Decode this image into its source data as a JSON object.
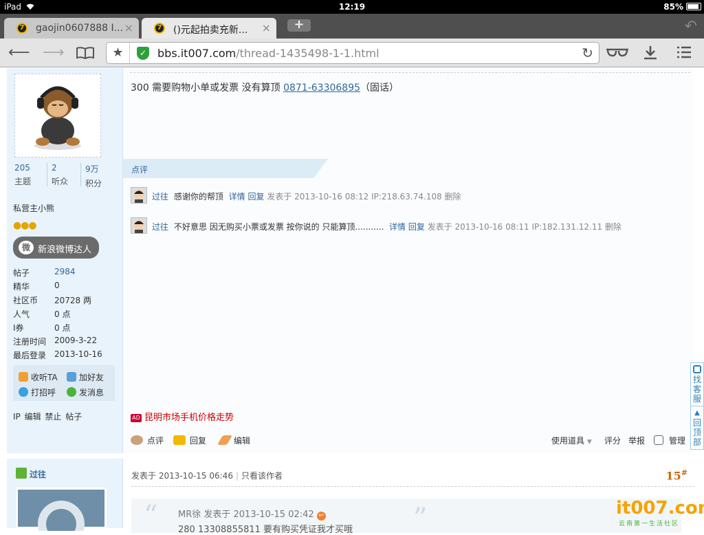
{
  "status_bar": {
    "device": "iPad",
    "time": "12:19",
    "battery": "85%"
  },
  "tabs": [
    {
      "title": "gaojin0607888 I...",
      "favicon": "7",
      "close": "×"
    },
    {
      "title": "()元起拍卖充新...",
      "favicon": "7",
      "close": "×"
    }
  ],
  "toolbar": {
    "url_host": "bbs.it007.com",
    "url_path": "/thread-1435498-1-1.html",
    "icons": [
      "back-icon",
      "forward-icon",
      "bookmarks-icon",
      "star-icon",
      "secure-shield-icon",
      "reload-icon",
      "reading-glasses-icon",
      "download-icon",
      "menu-icon"
    ]
  },
  "author": {
    "stats": [
      {
        "value": "205",
        "label": "主题"
      },
      {
        "value": "2",
        "label": "听众"
      },
      {
        "value": "9万",
        "label": "积分"
      }
    ],
    "title": "私营主小熊",
    "medal_label": "新浪微博达人",
    "profile": [
      {
        "k": "帖子",
        "v": "2984",
        "link": true
      },
      {
        "k": "精华",
        "v": "0"
      },
      {
        "k": "社区币",
        "v": "20728 两"
      },
      {
        "k": "人气",
        "v": "0 点"
      },
      {
        "k": "I券",
        "v": "0 点"
      },
      {
        "k": "注册时间",
        "v": "2009-3-22"
      },
      {
        "k": "最后登录",
        "v": "2013-10-16"
      }
    ],
    "actions": [
      "收听TA",
      "加好友",
      "打招呼",
      "发消息"
    ],
    "mod_links": "IP 编辑 禁止 帖子"
  },
  "post": {
    "message_prefix": "300 需要购物小单或发票 没有算顶 ",
    "phone": "0871-63306895",
    "message_suffix": "（固话）",
    "comment_header": "点评",
    "comments": [
      {
        "user": "过往",
        "text": "感谢你的帮顶",
        "detail": "详情",
        "reply": "回复",
        "meta": "发表于 2013-10-16 08:12 IP:218.63.74.108 删除"
      },
      {
        "user": "过往",
        "text": "不好意思 因无购买小票或发票 按你说的 只能算顶...........",
        "detail": "详情",
        "reply": "回复",
        "meta": "发表于 2013-10-16 08:11 IP:182.131.12.11 删除"
      }
    ],
    "ad_badge": "AD",
    "ad_text": "昆明市场手机价格走势",
    "actions": {
      "comment": "点评",
      "reply": "回复",
      "edit": "编辑",
      "tools": "使用道具",
      "rate": "评分",
      "report": "举报",
      "manage": "管理"
    }
  },
  "post2": {
    "author": "过往",
    "meta": "发表于 2013-10-15 06:46",
    "only_author": "只看该作者",
    "floor": "15",
    "floor_mark": "#",
    "quote_author": "MR徐 发表于 2013-10-15 02:42",
    "quote_text": "280   13308855811    要有购买凭证我才买哦"
  },
  "side_float": {
    "service": "找客服",
    "top": "回顶部"
  },
  "logo": {
    "text": "it007.com",
    "slogan": "云南第一生活社区"
  }
}
